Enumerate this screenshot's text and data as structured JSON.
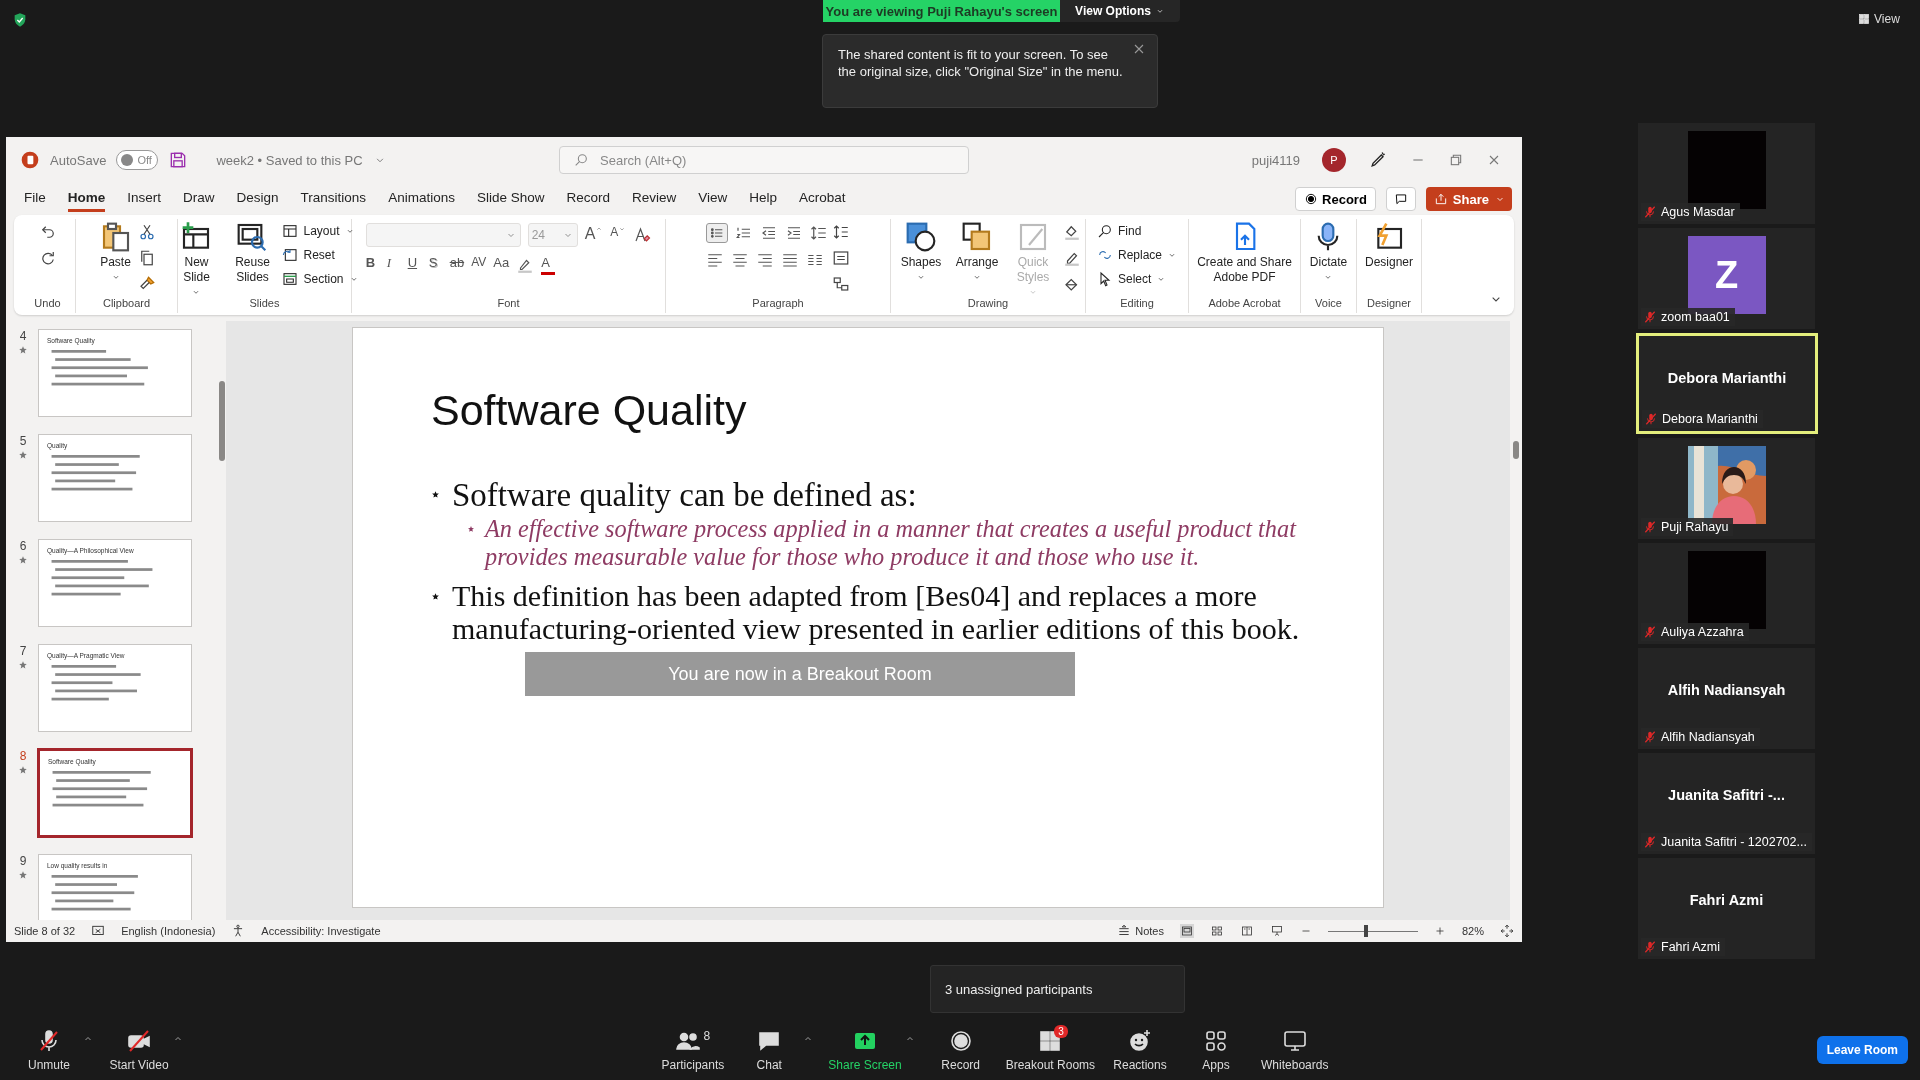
{
  "zoom": {
    "banner": "You are viewing Puji Rahayu's screen",
    "view_options": "View Options",
    "view_button": "View",
    "tooltip": "The shared content is fit to your screen. To see the original size, click \"Original Size\" in the menu.",
    "breakout_notice": "You are now in a Breakout Room",
    "unassigned_tooltip": "3 unassigned participants"
  },
  "powerpoint": {
    "titlebar": {
      "autosave": "AutoSave",
      "autosave_on": false,
      "toggle_label": "Off",
      "document": "week2 • Saved to this PC",
      "search_placeholder": "Search (Alt+Q)",
      "user": "puji4119",
      "avatar": "P"
    },
    "menu": [
      {
        "label": "File",
        "selected": false
      },
      {
        "label": "Home",
        "selected": true
      },
      {
        "label": "Insert",
        "selected": false
      },
      {
        "label": "Draw",
        "selected": false
      },
      {
        "label": "Design",
        "selected": false
      },
      {
        "label": "Transitions",
        "selected": false
      },
      {
        "label": "Animations",
        "selected": false
      },
      {
        "label": "Slide Show",
        "selected": false
      },
      {
        "label": "Record",
        "selected": false
      },
      {
        "label": "Review",
        "selected": false
      },
      {
        "label": "View",
        "selected": false
      },
      {
        "label": "Help",
        "selected": false
      },
      {
        "label": "Acrobat",
        "selected": false
      }
    ],
    "record_button": "Record",
    "share_button": "Share",
    "ribbon": [
      {
        "label": "Undo"
      },
      {
        "label": "Clipboard",
        "buttons": [
          {
            "label": "Paste",
            "kind": "big",
            "menu": true,
            "disabled": false
          }
        ]
      },
      {
        "label": "Slides",
        "buttons": [
          {
            "label": "New Slide",
            "kind": "big",
            "menu": true,
            "disabled": false
          },
          {
            "label": "Reuse Slides",
            "kind": "big",
            "menu": false,
            "disabled": false
          },
          {
            "label": "Layout",
            "kind": "small",
            "menu": true,
            "disabled": false
          },
          {
            "label": "Reset",
            "kind": "small",
            "menu": false,
            "disabled": false
          },
          {
            "label": "Section",
            "kind": "small",
            "menu": true,
            "disabled": false
          }
        ]
      },
      {
        "label": "Font",
        "font_size": "24",
        "size_buttons": [
          "A",
          "A"
        ],
        "format_buttons": [
          "B",
          "I",
          "U",
          "S",
          "ab",
          "AV",
          "Aa"
        ],
        "font_color": "A"
      },
      {
        "label": "Paragraph"
      },
      {
        "label": "Drawing",
        "buttons": [
          {
            "label": "Shapes",
            "kind": "big",
            "menu": true,
            "disabled": false
          },
          {
            "label": "Arrange",
            "kind": "big",
            "menu": true,
            "disabled": false
          },
          {
            "label": "Quick Styles",
            "kind": "big",
            "menu": true,
            "disabled": true
          }
        ]
      },
      {
        "label": "Editing",
        "buttons": [
          {
            "label": "Find",
            "kind": "small",
            "menu": false,
            "disabled": false
          },
          {
            "label": "Replace",
            "kind": "small",
            "menu": true,
            "disabled": false
          },
          {
            "label": "Select",
            "kind": "small",
            "menu": true,
            "disabled": false
          }
        ]
      },
      {
        "label": "Adobe Acrobat",
        "buttons": [
          {
            "label": "Create and Share Adobe PDF",
            "kind": "big",
            "menu": false,
            "disabled": false
          }
        ]
      },
      {
        "label": "Voice",
        "buttons": [
          {
            "label": "Dictate",
            "kind": "big",
            "menu": true,
            "disabled": false
          }
        ]
      },
      {
        "label": "Designer",
        "buttons": [
          {
            "label": "Designer",
            "kind": "big",
            "menu": false,
            "disabled": false
          }
        ]
      }
    ],
    "thumbnails": [
      {
        "number": "4",
        "title": "Software Quality",
        "selected": false
      },
      {
        "number": "5",
        "title": "Quality",
        "selected": false
      },
      {
        "number": "6",
        "title": "Quality—A Philosophical View",
        "selected": false
      },
      {
        "number": "7",
        "title": "Quality—A Pragmatic View",
        "selected": false
      },
      {
        "number": "8",
        "title": "Software Quality",
        "selected": true
      },
      {
        "number": "9",
        "title": "Low quality results in",
        "selected": false
      }
    ],
    "slide": {
      "title": "Software Quality",
      "bullets": [
        {
          "text": "Software quality can be defined as:",
          "children": [
            {
              "text": "An effective software process applied in a manner that creates a useful product that provides measurable value for those who produce it and those who use it."
            }
          ]
        },
        {
          "text": "This definition has been adapted from [Bes04] and replaces a more manufacturing-oriented view presented in earlier editions of this book."
        }
      ]
    },
    "status": {
      "slide": "Slide 8 of 32",
      "language": "English (Indonesia)",
      "accessibility": "Accessibility: Investigate",
      "notes": "Notes",
      "zoom": "82%",
      "zoom_slider": {
        "level": 0.42
      }
    }
  },
  "participants": [
    {
      "label": "Agus Masdar",
      "kind": "video",
      "muted": true,
      "active": false
    },
    {
      "label": "zoom baa01",
      "kind": "avatar",
      "initial": "Z",
      "muted": true,
      "active": false
    },
    {
      "label": "Debora Marianthi",
      "kind": "name",
      "heading": "Debora Marianthi",
      "muted": true,
      "active": true
    },
    {
      "label": "Puji Rahayu",
      "muted": true,
      "active": false
    },
    {
      "label": "Auliya Azzahra",
      "kind": "video",
      "muted": true,
      "active": false
    },
    {
      "label": "Alfih Nadiansyah",
      "kind": "name",
      "heading": "Alfih Nadiansyah",
      "muted": true,
      "active": false
    },
    {
      "label": "Juanita Safitri - 1202702...",
      "kind": "name",
      "heading": "Juanita Safitri -...",
      "muted": true,
      "active": false
    },
    {
      "label": "Fahri Azmi",
      "kind": "name",
      "heading": "Fahri Azmi",
      "muted": true,
      "active": false
    }
  ],
  "toolbar": {
    "left": [
      {
        "label": "Unmute",
        "menu": true,
        "accent": false
      },
      {
        "label": "Start Video",
        "menu": true,
        "accent": false
      }
    ],
    "center": [
      {
        "label": "Participants",
        "count": "8",
        "menu": false,
        "accent": false
      },
      {
        "label": "Chat",
        "menu": true,
        "accent": false
      },
      {
        "label": "Share Screen",
        "menu": true,
        "accent": true
      },
      {
        "label": "Record",
        "menu": false,
        "accent": false
      },
      {
        "label": "Breakout Rooms",
        "badge": "3",
        "menu": false,
        "accent": false
      },
      {
        "label": "Reactions",
        "menu": false,
        "accent": false
      },
      {
        "label": "Apps",
        "menu": false,
        "accent": false
      },
      {
        "label": "Whiteboards",
        "menu": false,
        "accent": false
      }
    ],
    "leave": "Leave Room"
  }
}
